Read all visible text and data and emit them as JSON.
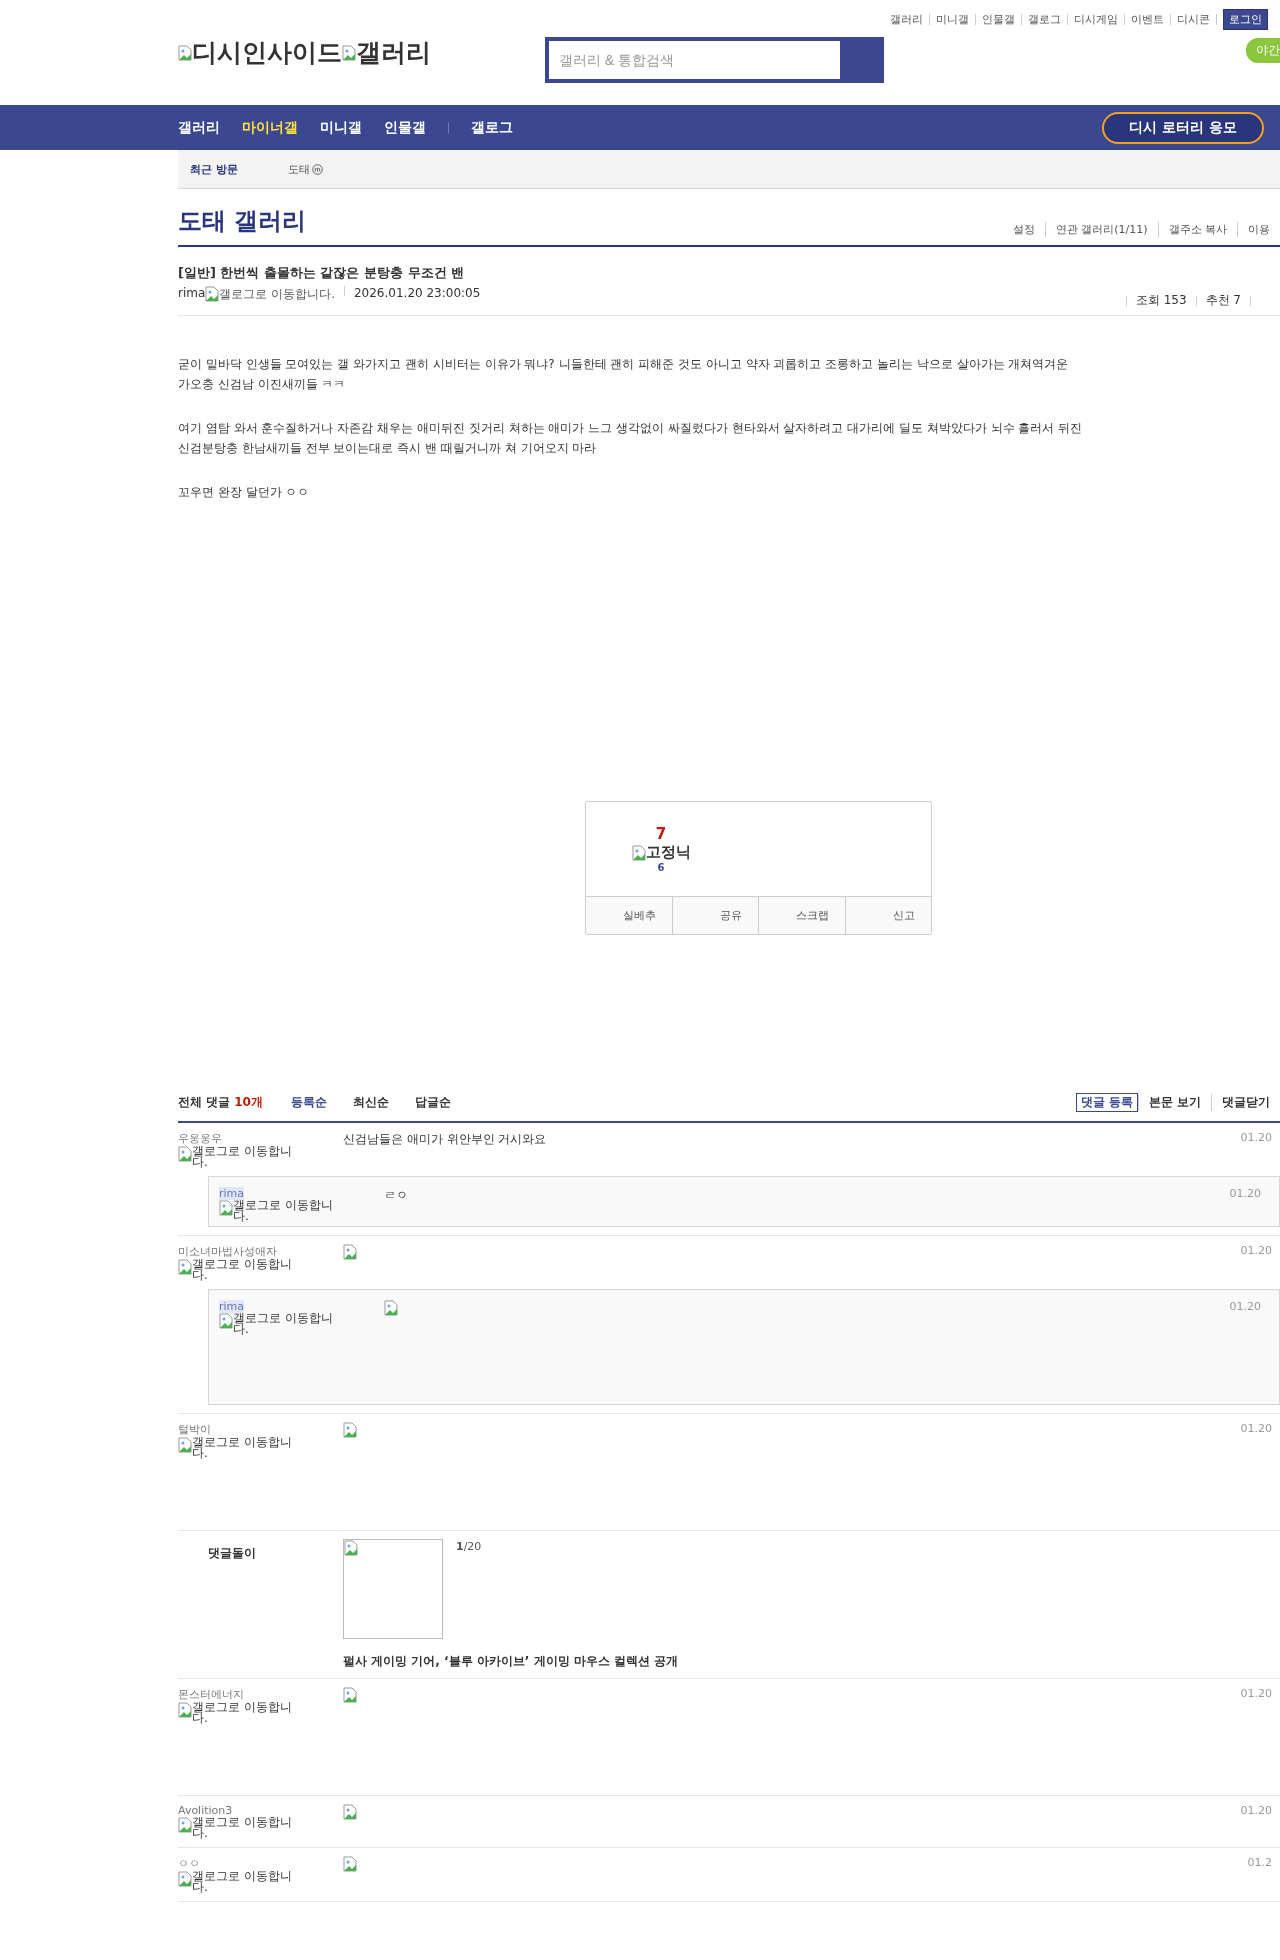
{
  "top_links": [
    "갤러리",
    "미니갤",
    "인물갤",
    "갤로그",
    "디시게임",
    "이벤트",
    "디시콘"
  ],
  "login_button": "로그인",
  "night_mode_button": "야간",
  "logo": {
    "site_alt": "디시인사이드",
    "gallery_alt": "갤러리"
  },
  "search": {
    "placeholder": "갤러리 & 통합검색"
  },
  "nav": [
    {
      "label": "갤러리",
      "selected": false
    },
    {
      "label": "마이너갤",
      "selected": true
    },
    {
      "label": "미니갤",
      "selected": false
    },
    {
      "label": "인물갤",
      "selected": false
    },
    {
      "label": "갤로그",
      "selected": false
    }
  ],
  "lottery_button": "디시 로터리 응모",
  "recent": {
    "label": "최근 방문",
    "items": [
      "도태"
    ]
  },
  "gallery": {
    "title": "도태 갤러리",
    "links": [
      "설정",
      "연관 갤러리(1/11)",
      "갤주소 복사",
      "이용"
    ]
  },
  "post": {
    "title": "[일반] 한번씩 출몰하는 같잖은 분탕충 무조건 밴",
    "author": "rima",
    "author_badge_alt": "갤로그로 이동합니다.",
    "date": "2026.01.20 23:00:05",
    "views": "조회 153",
    "recommend": "추천 7",
    "paragraphs": [
      "굳이 밑바닥 인생들 모여있는 갤 와가지고 괜히 시비터는 이유가 뭐냐? 니들한테 괜히 피해준 것도 아니고 약자 괴롭히고 조롱하고 놀리는 낙으로 살아가는 개쳐역겨운 가오충 신검남 이진새끼들 ㅋㅋ",
      "여기 염탐 와서 훈수질하거나 자존감 채우는 애미뒤진 짓거리 쳐하는 애미가 느그 생각없이 싸질렀다가 현타와서 살자하려고 대가리에 딜도 쳐박았다가 뇌수 흘러서 뒤진 신검분탕충 한남새끼들 전부 보이는대로 즉시 밴 때릴거니까 쳐 기어오지 마라",
      "꼬우면 완장 달던가 ㅇㅇ"
    ]
  },
  "vote": {
    "up_count": "7",
    "fixed_alt": "고정닉",
    "down_count": "6",
    "buttons": [
      "실베추",
      "공유",
      "스크랩",
      "신고"
    ]
  },
  "comments_header": {
    "label": "전체 댓글",
    "count": "10개",
    "sorts": [
      {
        "label": "등록순",
        "selected": true
      },
      {
        "label": "최신순",
        "selected": false
      },
      {
        "label": "답글순",
        "selected": false
      }
    ],
    "actions": [
      "댓글 등록",
      "본문 보기",
      "댓글닫기"
    ]
  },
  "comments": [
    {
      "kind": "comment",
      "author": "우웅웅우",
      "writer": false,
      "badge_alt": "갤로그로 이동합니다.",
      "body": {
        "kind": "text",
        "text": "신검남들은 애미가 위안부인 거시와요"
      },
      "date": "01.20",
      "replies": [
        {
          "author": "rima",
          "writer": true,
          "badge_alt": "갤로그로 이동합니다.",
          "body": {
            "kind": "text",
            "text": "ㄹㅇ"
          },
          "date": "01.20"
        }
      ]
    },
    {
      "kind": "comment",
      "author": "미소녀마법사성애자",
      "writer": false,
      "badge_alt": "갤로그로 이동합니다.",
      "body": {
        "kind": "emoji"
      },
      "date": "01.20",
      "replies": [
        {
          "author": "rima",
          "writer": true,
          "badge_alt": "갤로그로 이동합니다.",
          "body": {
            "kind": "sticker"
          },
          "date": "01.20"
        }
      ]
    },
    {
      "kind": "comment",
      "author": "털박이",
      "writer": false,
      "badge_alt": "갤로그로 이동합니다.",
      "body": {
        "kind": "sticker"
      },
      "date": "01.20"
    },
    {
      "kind": "ad",
      "label": "댓글돌이",
      "counter": "**1**/20",
      "title": "펄사 게이밍 기어, ‘블루 아카이브’ 게이밍 마우스 컬렉션 공개"
    },
    {
      "kind": "comment",
      "author": "몬스터에너지",
      "writer": false,
      "badge_alt": "갤로그로 이동합니다.",
      "body": {
        "kind": "sticker"
      },
      "date": "01.20"
    },
    {
      "kind": "comment",
      "author": "Avolition3",
      "writer": false,
      "badge_alt": "갤로그로 이동합니다.",
      "body": {
        "kind": "emoji"
      },
      "date": "01.20"
    },
    {
      "kind": "comment",
      "author": "ㅇㅇ",
      "writer": false,
      "badge_alt": "갤로그로 이동합니다.",
      "body": {
        "kind": "emoji"
      },
      "date": "01.2"
    }
  ]
}
